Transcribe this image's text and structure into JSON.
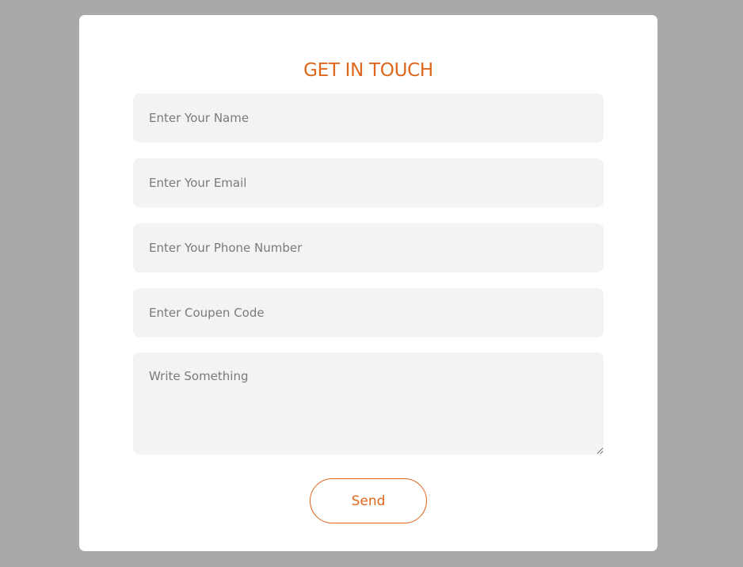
{
  "form": {
    "title": "GET IN TOUCH",
    "fields": {
      "name_placeholder": "Enter Your Name",
      "email_placeholder": "Enter Your Email",
      "phone_placeholder": "Enter Your Phone Number",
      "coupon_placeholder": "Enter Coupen Code",
      "message_placeholder": "Write Something"
    },
    "submit_label": "Send"
  },
  "colors": {
    "accent": "#e0661b",
    "page_background": "#aaa9a9",
    "card_background": "#ffffff",
    "field_background": "#f3f3f3"
  }
}
